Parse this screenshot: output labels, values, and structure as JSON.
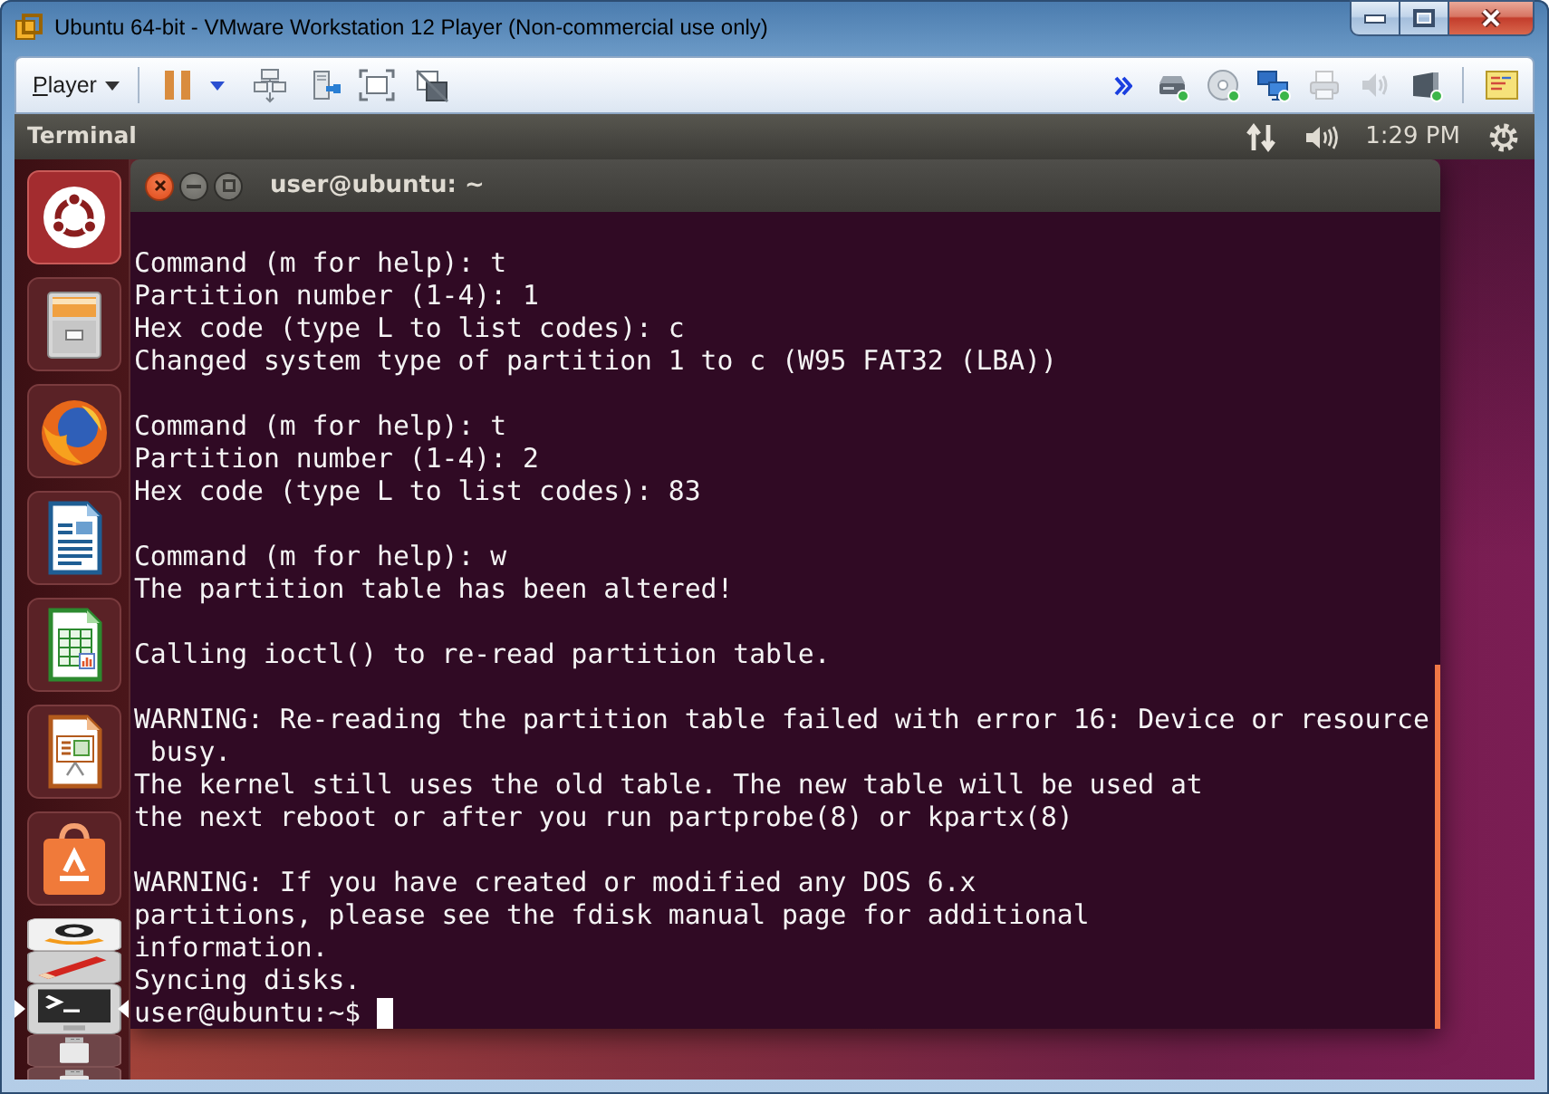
{
  "window": {
    "title": "Ubuntu 64-bit - VMware Workstation 12 Player (Non-commercial use only)"
  },
  "toolbar": {
    "menu_label": "Player",
    "devices": [
      {
        "kind": "hard-disk",
        "connected": true
      },
      {
        "kind": "cd",
        "connected": true
      },
      {
        "kind": "network",
        "connected": true
      },
      {
        "kind": "printer",
        "connected": false
      },
      {
        "kind": "sound",
        "connected": false
      },
      {
        "kind": "usb",
        "connected": true
      }
    ]
  },
  "top_panel": {
    "app_name": "Terminal",
    "clock": "1:29 PM"
  },
  "launcher": {
    "items": [
      {
        "kind": "home",
        "folded": false,
        "active": false
      },
      {
        "kind": "files",
        "folded": false,
        "active": false
      },
      {
        "kind": "browser",
        "folded": false,
        "active": false
      },
      {
        "kind": "writer",
        "folded": false,
        "active": false
      },
      {
        "kind": "calc",
        "folded": false,
        "active": false
      },
      {
        "kind": "impress",
        "folded": false,
        "active": false
      },
      {
        "kind": "store",
        "folded": false,
        "active": false
      },
      {
        "kind": "shop",
        "folded": true,
        "active": false
      },
      {
        "kind": "tools",
        "folded": true,
        "active": false
      },
      {
        "kind": "terminal",
        "folded": true,
        "active": true
      },
      {
        "kind": "usb",
        "folded": true,
        "active": false
      },
      {
        "kind": "usb",
        "folded": true,
        "active": false
      }
    ]
  },
  "terminal": {
    "title": "user@ubuntu: ~",
    "blocks": [
      [
        "Command (m for help): t",
        "Partition number (1-4): 1",
        "Hex code (type L to list codes): c",
        "Changed system type of partition 1 to c (W95 FAT32 (LBA))"
      ],
      [
        "Command (m for help): t",
        "Partition number (1-4): 2",
        "Hex code (type L to list codes): 83"
      ],
      [
        "Command (m for help): w",
        "The partition table has been altered!"
      ],
      [
        "Calling ioctl() to re-read partition table."
      ],
      [
        "WARNING: Re-reading the partition table failed with error 16: Device or resource",
        " busy.",
        "The kernel still uses the old table. The new table will be used at",
        "the next reboot or after you run partprobe(8) or kpartx(8)"
      ],
      [
        "WARNING: If you have created or modified any DOS 6.x",
        "partitions, please see the fdisk manual page for additional",
        "information.",
        "Syncing disks."
      ]
    ],
    "prompt": "user@ubuntu:~$",
    "cursor_visible": true
  }
}
